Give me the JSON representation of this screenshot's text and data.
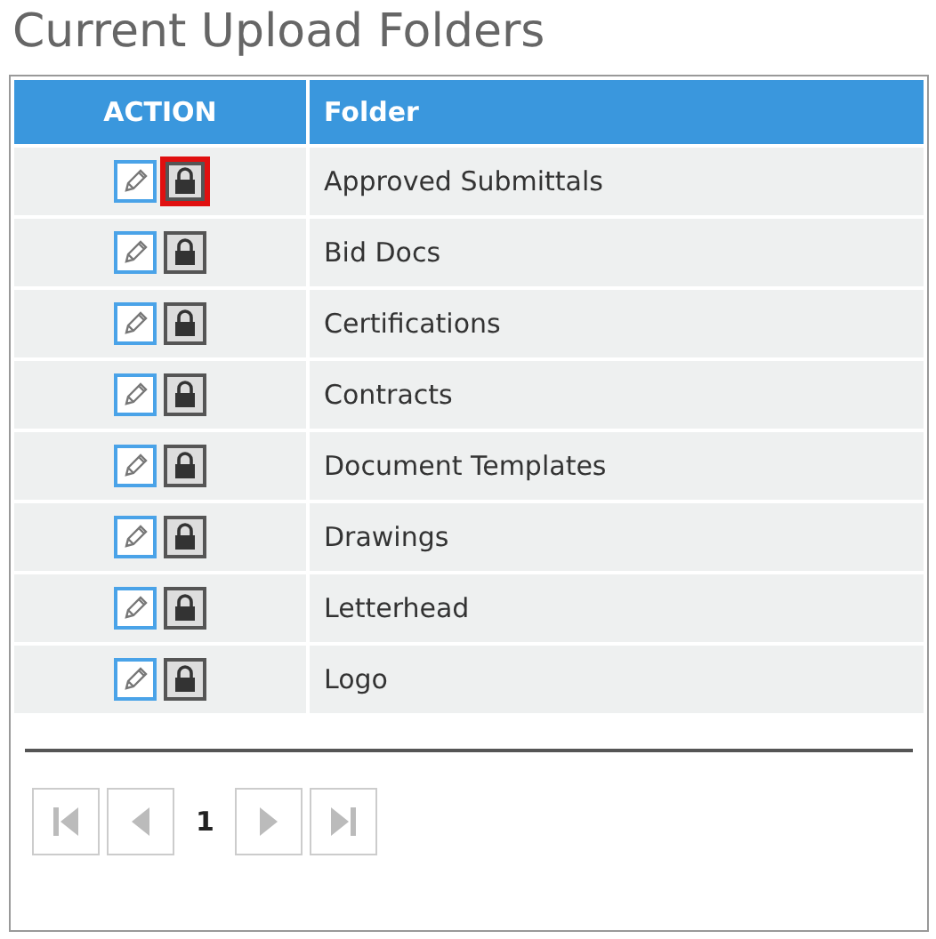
{
  "title": "Current Upload Folders",
  "table": {
    "columns": [
      "ACTION",
      "Folder"
    ],
    "rows": [
      {
        "folder": "Approved Submittals",
        "lock_highlighted": true
      },
      {
        "folder": "Bid Docs",
        "lock_highlighted": false
      },
      {
        "folder": "Certifications",
        "lock_highlighted": false
      },
      {
        "folder": "Contracts",
        "lock_highlighted": false
      },
      {
        "folder": "Document Templates",
        "lock_highlighted": false
      },
      {
        "folder": "Drawings",
        "lock_highlighted": false
      },
      {
        "folder": "Letterhead",
        "lock_highlighted": false
      },
      {
        "folder": "Logo",
        "lock_highlighted": false
      }
    ]
  },
  "pager": {
    "page": "1"
  }
}
